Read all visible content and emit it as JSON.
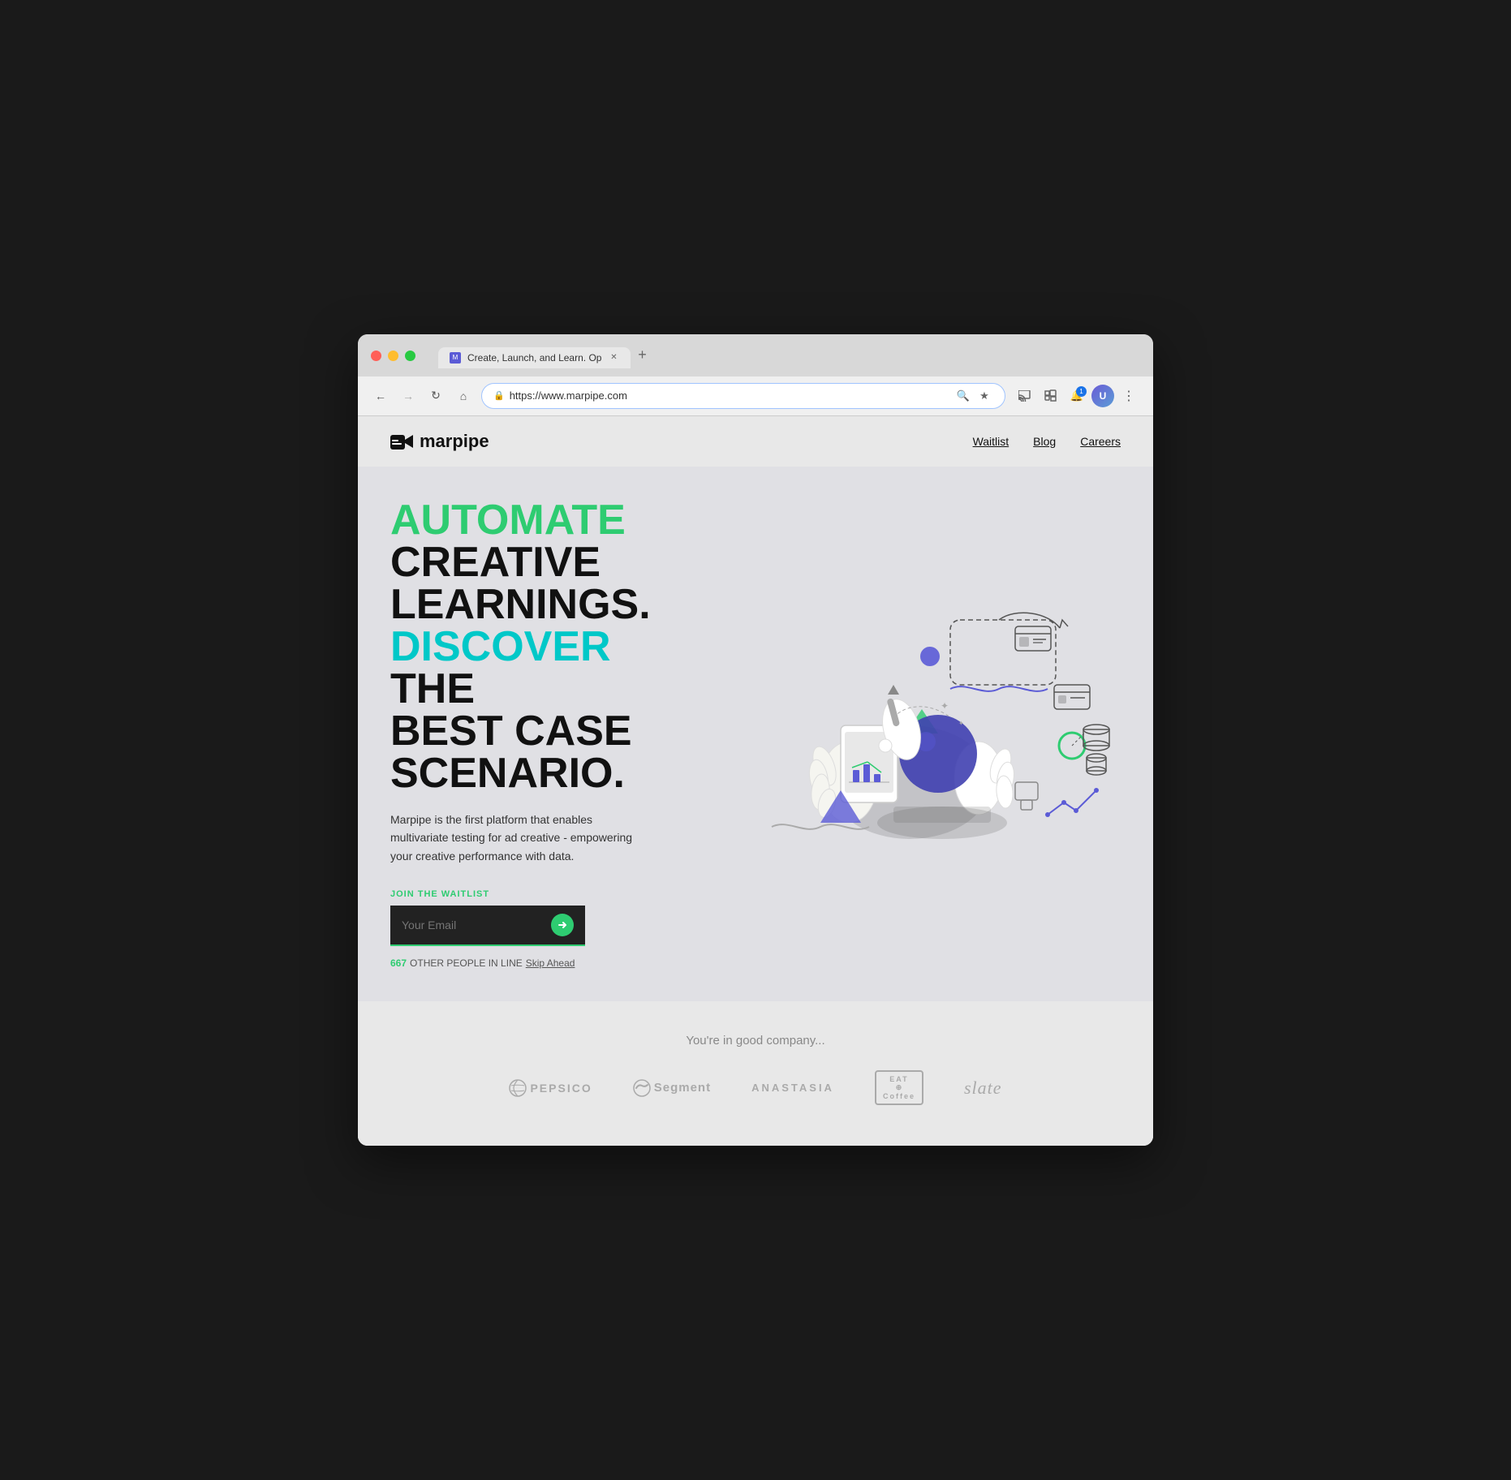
{
  "browser": {
    "tab_title": "Create, Launch, and Learn. Op",
    "tab_favicon": "M",
    "url": "https://www.marpipe.com",
    "new_tab_label": "+",
    "nav": {
      "back_disabled": false,
      "forward_disabled": true,
      "reload": "↻",
      "home": "⌂"
    }
  },
  "site": {
    "logo": "marpipe",
    "nav": {
      "links": [
        "Waitlist",
        "Blog",
        "Careers"
      ]
    },
    "hero": {
      "title_line1": "AUTOMATE",
      "title_line2": "CREATIVE",
      "title_line3": "LEARNINGS.",
      "title_line4_colored": "DISCOVER",
      "title_line4_rest": " THE",
      "title_line5": "BEST CASE",
      "title_line6": "SCENARIO.",
      "description": "Marpipe is the first platform that enables multivariate testing for ad creative - empowering your creative performance with data.",
      "waitlist_label": "JOIN THE WAITLIST",
      "email_placeholder": "Your Email",
      "waitlist_count": "667",
      "waitlist_text": "OTHER PEOPLE IN LINE",
      "skip_link": "Skip Ahead"
    },
    "company_section": {
      "tagline": "You're in good company...",
      "logos": [
        {
          "name": "PepsiCo",
          "type": "pepsico"
        },
        {
          "name": "Segment",
          "type": "segment"
        },
        {
          "name": "ANASTASIA",
          "type": "anastasia"
        },
        {
          "name": "EAT Coffee",
          "type": "eat-coffee"
        },
        {
          "name": "slate",
          "type": "slate"
        }
      ]
    }
  }
}
